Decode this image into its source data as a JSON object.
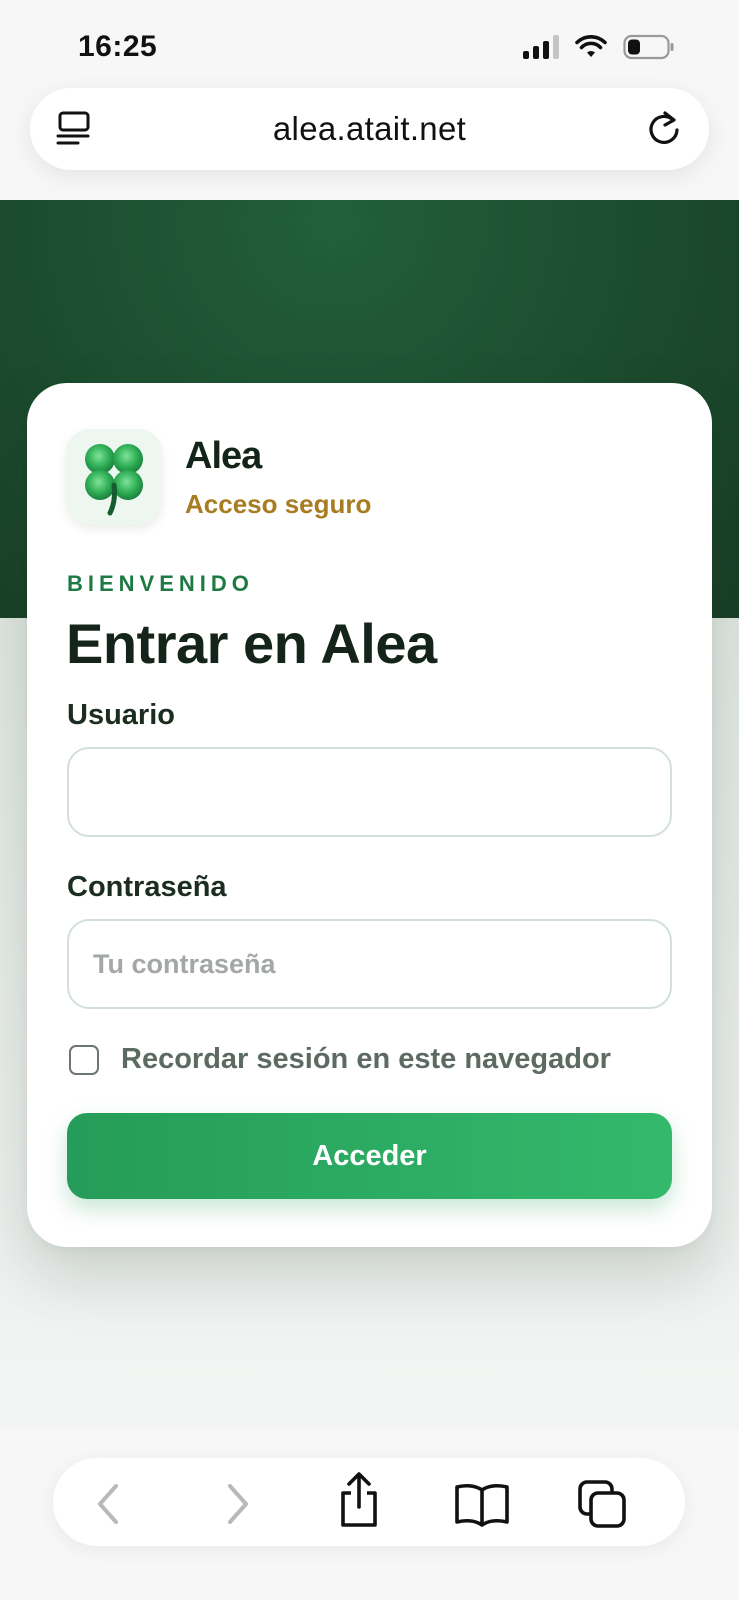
{
  "status_bar": {
    "time": "16:25",
    "icons": [
      "cellular-signal-icon",
      "wifi-icon",
      "battery-icon"
    ]
  },
  "browser": {
    "url": "alea.atait.net",
    "left_icon": "reader-view-icon",
    "right_icon": "reload-icon"
  },
  "app": {
    "name": "Alea",
    "subtitle": "Acceso seguro",
    "icon": "four-leaf-clover-icon"
  },
  "login": {
    "eyebrow": "BIENVENIDO",
    "title": "Entrar en Alea",
    "username_label": "Usuario",
    "username_value": "",
    "password_label": "Contraseña",
    "password_placeholder": "Tu contraseña",
    "remember_label": "Recordar sesión en este navegador",
    "remember_checked": false,
    "submit_label": "Acceder"
  },
  "toolbar": {
    "items": [
      "back-icon",
      "forward-icon",
      "share-icon",
      "bookmarks-icon",
      "tabs-icon"
    ]
  },
  "colors": {
    "hero": "#1d4f30",
    "accent_green": "#2eaa62",
    "gold": "#a87d22",
    "eyebrow": "#1e7a44"
  }
}
